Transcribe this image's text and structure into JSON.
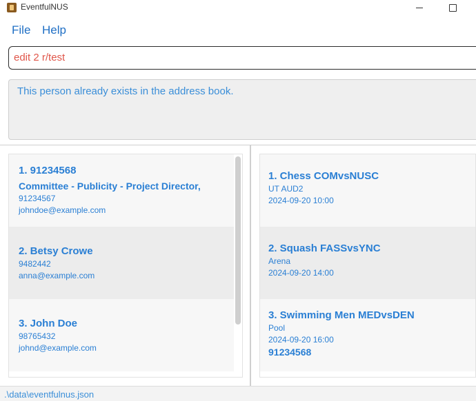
{
  "window": {
    "title": "EventfulNUS"
  },
  "menu": {
    "file": "File",
    "help": "Help"
  },
  "command": {
    "value": "edit 2 r/test"
  },
  "result": {
    "message": "This person already exists in the address book."
  },
  "persons": [
    {
      "title": "1. 91234568",
      "role": "Committee - Publicity - Project Director,",
      "phone": "91234567",
      "email": "johndoe@example.com"
    },
    {
      "title": "2. Betsy Crowe",
      "phone": "9482442",
      "email": "anna@example.com"
    },
    {
      "title": "3. John Doe",
      "phone": "98765432",
      "email": "johnd@example.com"
    }
  ],
  "events": [
    {
      "title": "1. Chess COMvsNUSC",
      "venue": "UT AUD2",
      "datetime": "2024-09-20 10:00"
    },
    {
      "title": "2. Squash FASSvsYNC",
      "venue": "Arena",
      "datetime": "2024-09-20 14:00"
    },
    {
      "title": "3. Swimming Men MEDvsDEN",
      "venue": "Pool",
      "datetime": "2024-09-20 16:00",
      "participant": "91234568"
    }
  ],
  "status": {
    "path": ".\\data\\eventfulnus.json"
  }
}
